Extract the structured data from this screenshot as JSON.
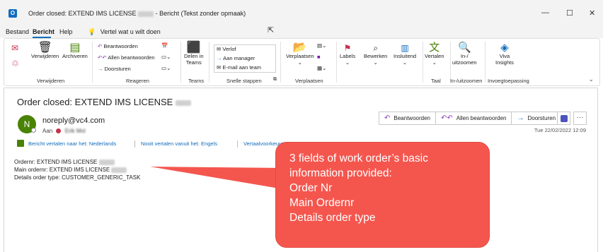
{
  "window": {
    "title": "Order closed: EXTEND IMS LICENSE",
    "title_suffix": "- Bericht (Tekst zonder opmaak)",
    "minimize": "—",
    "maximize": "☐",
    "close": "✕"
  },
  "menu": {
    "tabs": [
      "Bestand",
      "Bericht",
      "Help"
    ],
    "tell_me": "Vertel wat u wilt doen"
  },
  "ribbon": {
    "delete_group": {
      "label": "Verwijderen",
      "delete": "Verwijderen",
      "archive": "Archiveren"
    },
    "respond_group": {
      "label": "Reageren",
      "reply": "Beantwoorden",
      "reply_all": "Allen beantwoorden",
      "forward": "Doorsturen"
    },
    "teams_group": {
      "label": "Teams",
      "share_line1": "Delen in",
      "share_line2": "Teams"
    },
    "quick_steps": {
      "label": "Snelle stappen",
      "items": [
        "Verlof",
        "Aan manager",
        "E-mail aan team"
      ]
    },
    "move_group": {
      "label": "Verplaatsen",
      "move": "Verplaatsen"
    },
    "tags": {
      "labels": "Labels",
      "edit": "Bewerken",
      "immersive": "Insluitend"
    },
    "language": {
      "label": "Taal",
      "translate": "Vertalen"
    },
    "zoom": {
      "label": "In-/uitzoomen",
      "zoom_line1": "In-/",
      "zoom_line2": "uitzoomen"
    },
    "addins": {
      "label": "Invoegtoepassing",
      "viva_line1": "Viva",
      "viva_line2": "Insights"
    }
  },
  "message": {
    "subject": "Order closed: EXTEND IMS LICENSE",
    "avatar_initial": "N",
    "sender": "noreply@vc4.com",
    "to_label": "Aan",
    "recipient": "Erik Mol",
    "actions": [
      "Beantwoorden",
      "Allen beantwoorden",
      "Doorsturen"
    ],
    "more": "···",
    "date": "Tue 22/02/2022 12:09",
    "translate": {
      "translate_to": "Bericht vertalen naar het: Nederlands",
      "never": "Nooit vertalen vanuit het: Engels",
      "prefs": "Vertaalvoorkeuren"
    },
    "body": [
      "Ordernr: EXTEND IMS LICENSE",
      "Main ordernr: EXTEND IMS LICENSE",
      "Details order type: CUSTOMER_GENERIC_TASK"
    ]
  },
  "callout": {
    "lines": [
      "3 fields of work order’s basic",
      "information provided:",
      "Order Nr",
      "Main Ordernr",
      "Details order type"
    ],
    "color": "#f4564e"
  },
  "colors": {
    "accent": "#0f6cbd",
    "avatar": "#498205",
    "action_icon": "#8a3fb8"
  }
}
